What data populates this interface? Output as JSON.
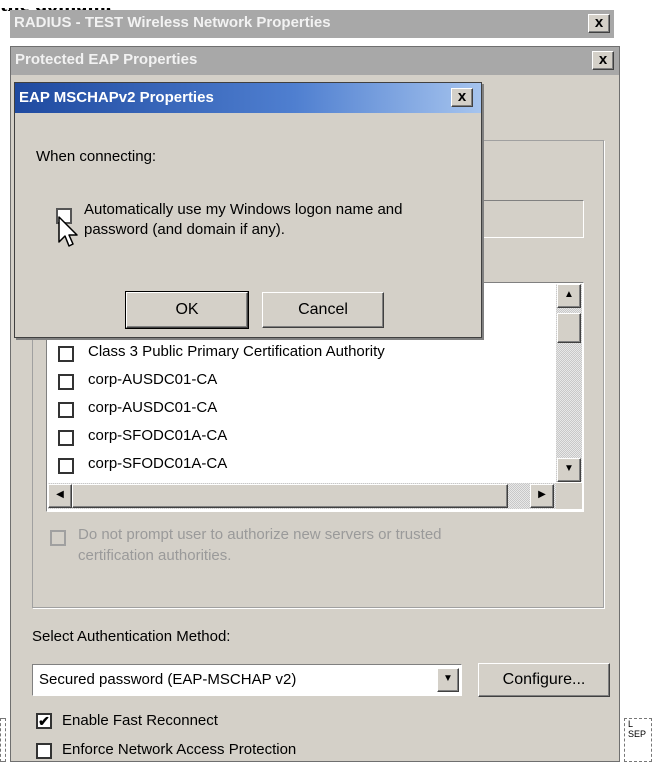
{
  "page_heading": "the domain.",
  "outer_window": {
    "title": "RADIUS - TEST Wireless Network Properties",
    "close_label": "x"
  },
  "peap_window": {
    "title": "Protected EAP Properties",
    "close_label": "x"
  },
  "dialog": {
    "title": "EAP MSCHAPv2 Properties",
    "close_label": "x",
    "heading": "When connecting:",
    "auto_logon_line1": "Automatically use my Windows logon name and",
    "auto_logon_line2": "password (and domain if any).",
    "auto_logon_checked": false,
    "ok_label": "OK",
    "cancel_label": "Cancel"
  },
  "ca_list": {
    "items": [
      {
        "label": "Class 3 Public Primary Certification Authority",
        "checked": false
      },
      {
        "label": "corp-AUSDC01-CA",
        "checked": false
      },
      {
        "label": "corp-AUSDC01-CA",
        "checked": false
      },
      {
        "label": "corp-SFODC01A-CA",
        "checked": false
      },
      {
        "label": "corp-SFODC01A-CA",
        "checked": false
      }
    ]
  },
  "no_prompt": {
    "line1": "Do not prompt user to authorize new servers or trusted",
    "line2": "certification authorities."
  },
  "auth_method": {
    "label": "Select Authentication Method:",
    "selected": "Secured password (EAP-MSCHAP v2)",
    "configure_label": "Configure..."
  },
  "fast_reconnect": {
    "label": "Enable Fast Reconnect",
    "checked": true
  },
  "nap": {
    "label": "Enforce Network Access Protection",
    "checked": false
  },
  "side_marker": {
    "line1": "L",
    "line2": "SEP"
  }
}
